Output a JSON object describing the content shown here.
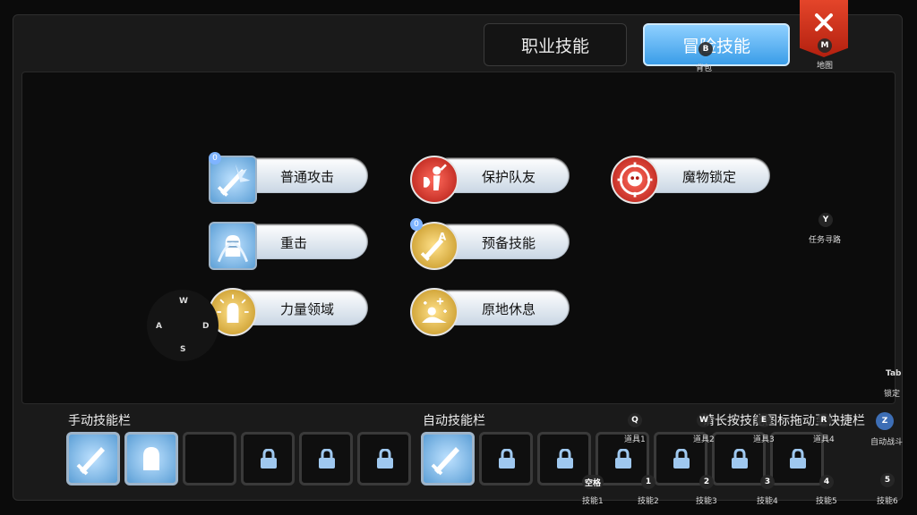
{
  "tabs": {
    "job": "职业技能",
    "adventure": "冒险技能"
  },
  "close": {
    "key": "M",
    "hint": "地图"
  },
  "bag": {
    "key": "B",
    "hint": "背包"
  },
  "quest_nav": {
    "key": "Y",
    "hint": "任务寻路"
  },
  "lock_target": {
    "key": "Tab",
    "hint": "锁定"
  },
  "auto_battle": {
    "key": "Z",
    "hint": "自动战斗"
  },
  "skills": [
    {
      "label": "普通攻击",
      "badge": "0"
    },
    {
      "label": "保护队友"
    },
    {
      "label": "魔物锁定"
    },
    {
      "label": "重击"
    },
    {
      "label": "预备技能",
      "badge": "0"
    },
    {
      "label": "力量领域"
    },
    {
      "label": "原地休息"
    }
  ],
  "dpad": {
    "up": "W",
    "left": "A",
    "right": "D",
    "down": "S"
  },
  "bars": {
    "manual": "手动技能栏",
    "auto": "自动技能栏",
    "hint": "请长按技能图标拖动至快捷栏"
  },
  "item_keys": [
    {
      "key": "Q",
      "label": "道具1"
    },
    {
      "key": "W",
      "label": "道具2"
    },
    {
      "key": "E",
      "label": "道具3"
    },
    {
      "key": "R",
      "label": "道具4"
    }
  ],
  "skill_keys": [
    {
      "key": "空格",
      "label": "技能1"
    },
    {
      "key": "1",
      "label": "技能2"
    },
    {
      "key": "2",
      "label": "技能3"
    },
    {
      "key": "3",
      "label": "技能4"
    },
    {
      "key": "4",
      "label": "技能5"
    },
    {
      "key": "5",
      "label": "技能6"
    }
  ]
}
